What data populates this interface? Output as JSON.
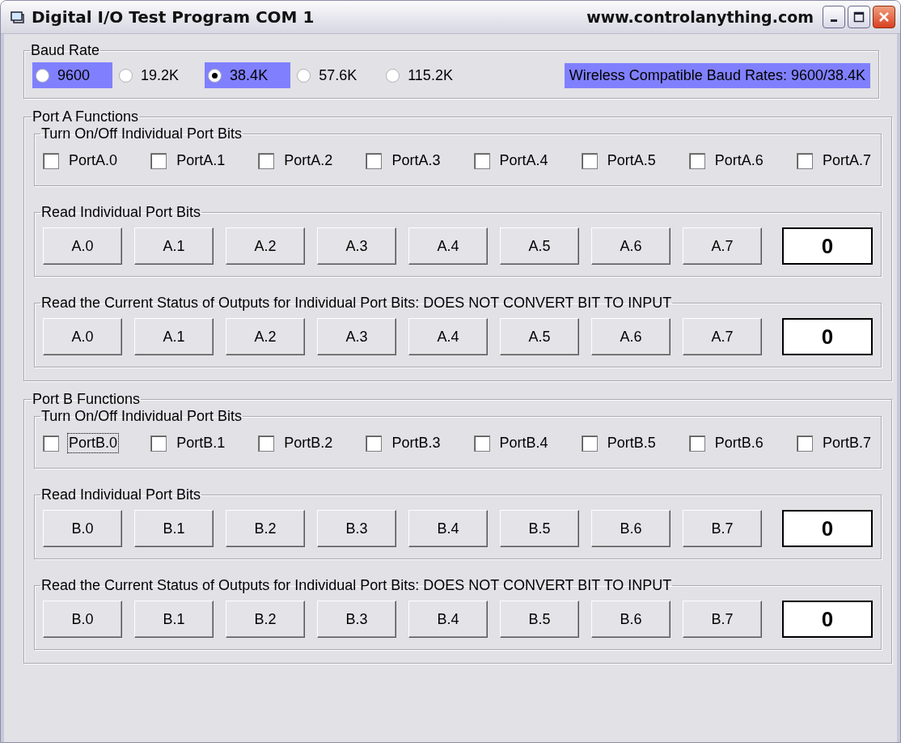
{
  "window": {
    "title": "Digital I/O Test Program COM 1",
    "website": "www.controlanything.com"
  },
  "baud_rate": {
    "label": "Baud Rate",
    "options": [
      {
        "label": "9600",
        "selected": false,
        "highlighted": true
      },
      {
        "label": "19.2K",
        "selected": false,
        "highlighted": false
      },
      {
        "label": "38.4K",
        "selected": true,
        "highlighted": true
      },
      {
        "label": "57.6K",
        "selected": false,
        "highlighted": false
      },
      {
        "label": "115.2K",
        "selected": false,
        "highlighted": false
      }
    ],
    "note": "Wireless Compatible Baud Rates: 9600/38.4K"
  },
  "ports": [
    {
      "label": "Port A Functions",
      "groups": [
        {
          "kind": "checkboxes",
          "label": "Turn On/Off Individual Port Bits",
          "items": [
            {
              "label": "PortA.0",
              "checked": false,
              "focused": false
            },
            {
              "label": "PortA.1",
              "checked": false,
              "focused": false
            },
            {
              "label": "PortA.2",
              "checked": false,
              "focused": false
            },
            {
              "label": "PortA.3",
              "checked": false,
              "focused": false
            },
            {
              "label": "PortA.4",
              "checked": false,
              "focused": false
            },
            {
              "label": "PortA.5",
              "checked": false,
              "focused": false
            },
            {
              "label": "PortA.6",
              "checked": false,
              "focused": false
            },
            {
              "label": "PortA.7",
              "checked": false,
              "focused": false
            }
          ]
        },
        {
          "kind": "buttons",
          "label": "Read Individual Port Bits",
          "buttons": [
            "A.0",
            "A.1",
            "A.2",
            "A.3",
            "A.4",
            "A.5",
            "A.6",
            "A.7"
          ],
          "value": "0"
        },
        {
          "kind": "buttons",
          "label": "Read the Current Status of Outputs for Individual Port Bits: DOES NOT CONVERT BIT TO INPUT",
          "buttons": [
            "A.0",
            "A.1",
            "A.2",
            "A.3",
            "A.4",
            "A.5",
            "A.6",
            "A.7"
          ],
          "value": "0"
        }
      ]
    },
    {
      "label": "Port B Functions",
      "groups": [
        {
          "kind": "checkboxes",
          "label": "Turn On/Off Individual Port Bits",
          "items": [
            {
              "label": "PortB.0",
              "checked": false,
              "focused": true
            },
            {
              "label": "PortB.1",
              "checked": false,
              "focused": false
            },
            {
              "label": "PortB.2",
              "checked": false,
              "focused": false
            },
            {
              "label": "PortB.3",
              "checked": false,
              "focused": false
            },
            {
              "label": "PortB.4",
              "checked": false,
              "focused": false
            },
            {
              "label": "PortB.5",
              "checked": false,
              "focused": false
            },
            {
              "label": "PortB.6",
              "checked": false,
              "focused": false
            },
            {
              "label": "PortB.7",
              "checked": false,
              "focused": false
            }
          ]
        },
        {
          "kind": "buttons",
          "label": "Read Individual Port Bits",
          "buttons": [
            "B.0",
            "B.1",
            "B.2",
            "B.3",
            "B.4",
            "B.5",
            "B.6",
            "B.7"
          ],
          "value": "0"
        },
        {
          "kind": "buttons",
          "label": "Read the Current Status of Outputs for Individual Port Bits: DOES NOT CONVERT BIT TO INPUT",
          "buttons": [
            "B.0",
            "B.1",
            "B.2",
            "B.3",
            "B.4",
            "B.5",
            "B.6",
            "B.7"
          ],
          "value": "0"
        }
      ]
    }
  ]
}
